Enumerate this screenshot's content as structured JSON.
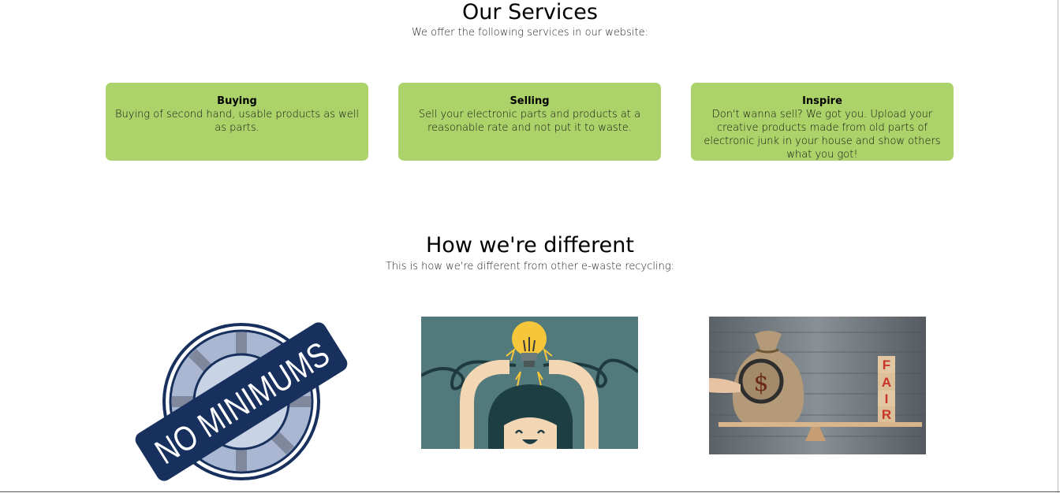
{
  "services": {
    "title": "Our Services",
    "subtitle": "We offer the following services in our website:",
    "cards": [
      {
        "title": "Buying",
        "description": "Buying of second hand, usable products as well as parts."
      },
      {
        "title": "Selling",
        "description": "Sell your electronic parts and products at a reasonable rate and not put it to waste."
      },
      {
        "title": "Inspire",
        "description": "Don't wanna sell? We got you. Upload your creative products made from old parts of electronic junk in your house and show others what you got!"
      }
    ]
  },
  "different": {
    "title": "How we're different",
    "subtitle": "This is how we're different from other e-waste recycling:",
    "images": [
      {
        "name": "no-minimums-badge",
        "text": "NO MINIMUMS"
      },
      {
        "name": "idea-lightbulb-illustration"
      },
      {
        "name": "fair-money-bag-photo",
        "letters": [
          "F",
          "A",
          "I",
          "R"
        ],
        "symbol": "$"
      }
    ]
  },
  "colors": {
    "card": "#acd26a",
    "badge_navy": "#17305d",
    "teal": "#52797c"
  }
}
